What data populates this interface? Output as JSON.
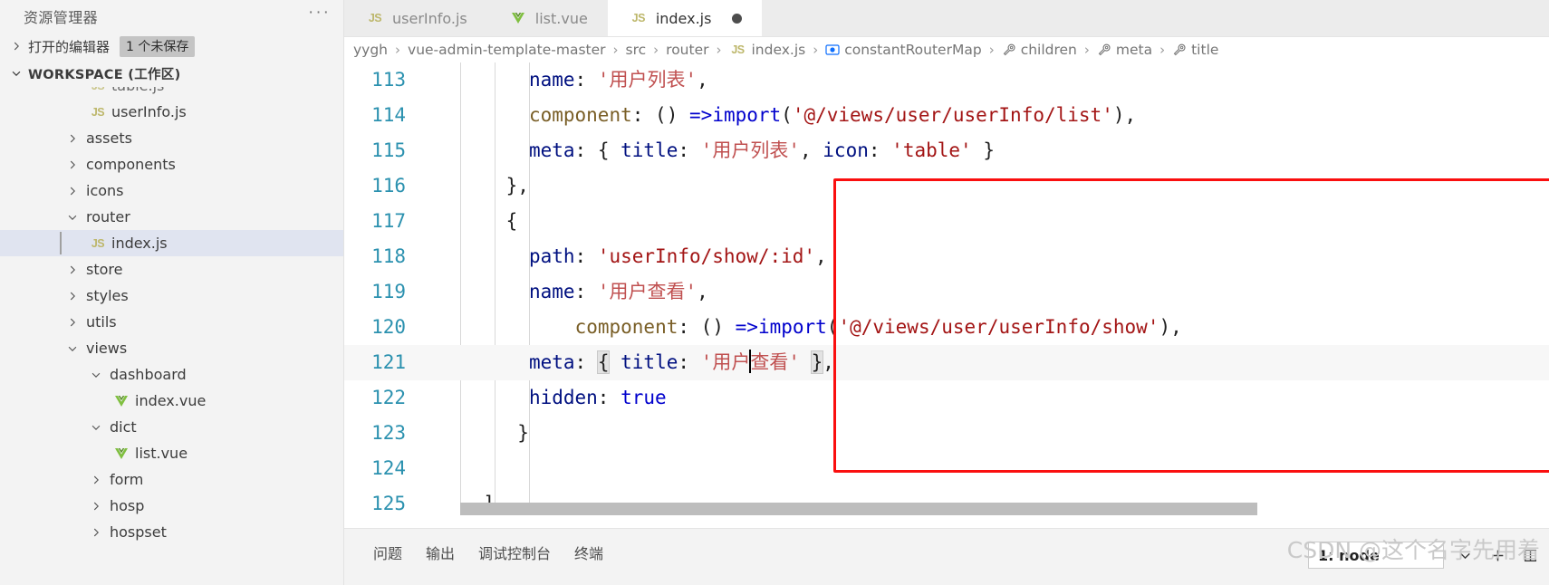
{
  "sidebar": {
    "title": "资源管理器",
    "more_label": "···",
    "open_editors": {
      "label": "打开的编辑器",
      "badge": "1 个未保存"
    },
    "workspace_label": "WORKSPACE (工作区)",
    "tree": [
      {
        "label": "table.js",
        "icon": "js-file-icon",
        "indent": 3,
        "arrow": "none",
        "partial": true,
        "selected": false
      },
      {
        "label": "userInfo.js",
        "icon": "js-file-icon",
        "indent": 3,
        "arrow": "none",
        "partial": false,
        "selected": false
      },
      {
        "label": "assets",
        "icon": "none",
        "indent": 2,
        "arrow": "right",
        "partial": false,
        "selected": false
      },
      {
        "label": "components",
        "icon": "none",
        "indent": 2,
        "arrow": "right",
        "partial": false,
        "selected": false
      },
      {
        "label": "icons",
        "icon": "none",
        "indent": 2,
        "arrow": "right",
        "partial": false,
        "selected": false
      },
      {
        "label": "router",
        "icon": "none",
        "indent": 2,
        "arrow": "down",
        "partial": false,
        "selected": false
      },
      {
        "label": "index.js",
        "icon": "js-file-icon",
        "indent": 3,
        "arrow": "none",
        "partial": false,
        "selected": true
      },
      {
        "label": "store",
        "icon": "none",
        "indent": 2,
        "arrow": "right",
        "partial": false,
        "selected": false
      },
      {
        "label": "styles",
        "icon": "none",
        "indent": 2,
        "arrow": "right",
        "partial": false,
        "selected": false
      },
      {
        "label": "utils",
        "icon": "none",
        "indent": 2,
        "arrow": "right",
        "partial": false,
        "selected": false
      },
      {
        "label": "views",
        "icon": "none",
        "indent": 2,
        "arrow": "down",
        "partial": false,
        "selected": false
      },
      {
        "label": "dashboard",
        "icon": "none",
        "indent": 3,
        "arrow": "down",
        "partial": false,
        "selected": false
      },
      {
        "label": "index.vue",
        "icon": "vue-file-icon",
        "indent": 4,
        "arrow": "none",
        "partial": false,
        "selected": false
      },
      {
        "label": "dict",
        "icon": "none",
        "indent": 3,
        "arrow": "down",
        "partial": false,
        "selected": false
      },
      {
        "label": "list.vue",
        "icon": "vue-file-icon",
        "indent": 4,
        "arrow": "none",
        "partial": false,
        "selected": false
      },
      {
        "label": "form",
        "icon": "none",
        "indent": 3,
        "arrow": "right",
        "partial": false,
        "selected": false
      },
      {
        "label": "hosp",
        "icon": "none",
        "indent": 3,
        "arrow": "right",
        "partial": false,
        "selected": false
      },
      {
        "label": "hospset",
        "icon": "none",
        "indent": 3,
        "arrow": "right",
        "partial": false,
        "selected": false
      }
    ]
  },
  "tabs": [
    {
      "label": "userInfo.js",
      "icon": "js-file-icon",
      "active": false,
      "dirty": false
    },
    {
      "label": "list.vue",
      "icon": "vue-file-icon",
      "active": false,
      "dirty": false
    },
    {
      "label": "index.js",
      "icon": "js-file-icon",
      "active": true,
      "dirty": true
    }
  ],
  "breadcrumb": [
    {
      "label": "yygh",
      "icon": "none"
    },
    {
      "label": "vue-admin-template-master",
      "icon": "none"
    },
    {
      "label": "src",
      "icon": "none"
    },
    {
      "label": "router",
      "icon": "none"
    },
    {
      "label": "index.js",
      "icon": "js-file-icon"
    },
    {
      "label": "constantRouterMap",
      "icon": "variable-icon"
    },
    {
      "label": "children",
      "icon": "property-icon"
    },
    {
      "label": "meta",
      "icon": "property-icon"
    },
    {
      "label": "title",
      "icon": "property-icon"
    }
  ],
  "breadcrumb_separator": "›",
  "code": {
    "lines": [
      {
        "num": "113",
        "text": "      name: '用户列表',"
      },
      {
        "num": "114",
        "text": "      component: () =>import('@/views/user/userInfo/list'),"
      },
      {
        "num": "115",
        "text": "      meta: { title: '用户列表', icon: 'table' }"
      },
      {
        "num": "116",
        "text": "    },"
      },
      {
        "num": "117",
        "text": "    {"
      },
      {
        "num": "118",
        "text": "      path: 'userInfo/show/:id',"
      },
      {
        "num": "119",
        "text": "      name: '用户查看',"
      },
      {
        "num": "120",
        "text": "          component: () =>import('@/views/user/userInfo/show'),"
      },
      {
        "num": "121",
        "text": "      meta: { title: '用户查看' },"
      },
      {
        "num": "122",
        "text": "      hidden: true"
      },
      {
        "num": "123",
        "text": "     }"
      },
      {
        "num": "124",
        "text": ""
      },
      {
        "num": "125",
        "text": "  ]"
      }
    ]
  },
  "panel": {
    "tabs": [
      "问题",
      "输出",
      "调试控制台",
      "终端"
    ],
    "terminal_selected": "1: node",
    "icons": [
      "chevron-down-icon",
      "add-icon",
      "split-icon"
    ]
  },
  "watermark": "CSDN @这个名字先用着",
  "colors": {
    "accent_red_box": "#fa0f0f",
    "line_number": "#2b91af",
    "string": "#a31515",
    "keyword": "#0000cd",
    "property": "#001080",
    "function": "#795e26",
    "selection": "#e0e4f0",
    "sidebar_bg": "#f3f3f3",
    "tabbar_bg": "#ececec"
  }
}
